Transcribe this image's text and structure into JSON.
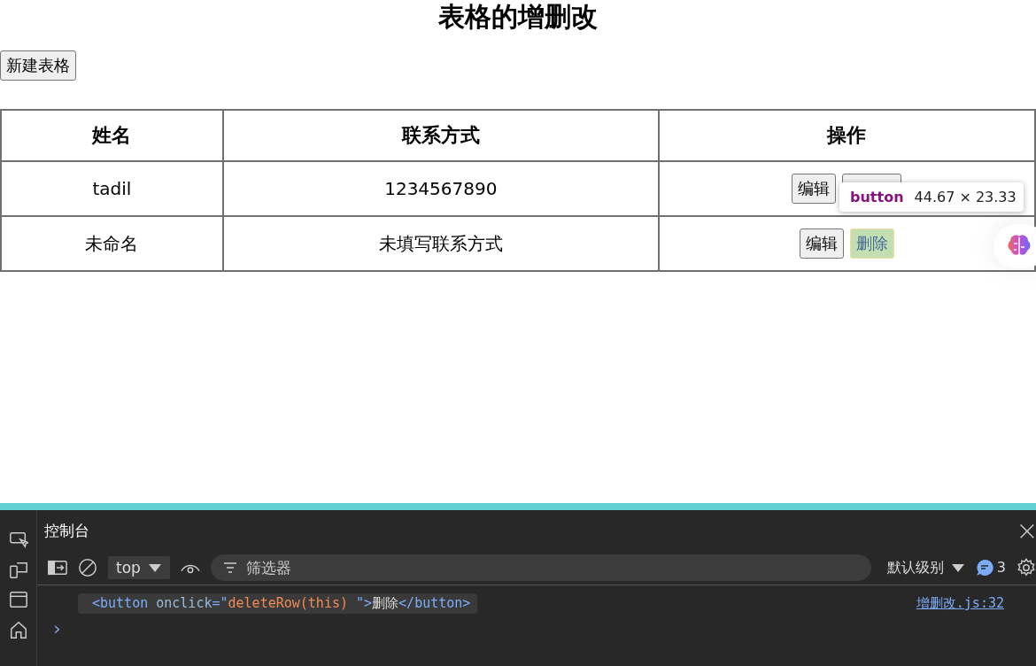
{
  "page": {
    "heading": "表格的增删改",
    "new_button": "新建表格"
  },
  "table": {
    "columns": [
      "姓名",
      "联系方式",
      "操作"
    ],
    "rows": [
      {
        "name": "tadil",
        "contact": "1234567890",
        "actions": [
          {
            "label": "编辑",
            "highlighted": false
          }
        ],
        "covered_button": true
      },
      {
        "name": "未命名",
        "contact": "未填写联系方式",
        "actions": [
          {
            "label": "编辑",
            "highlighted": false
          },
          {
            "label": "删除",
            "highlighted": true
          }
        ],
        "covered_button": false
      }
    ]
  },
  "inspect_tooltip": {
    "tag": "button",
    "size": "44.67 × 23.33"
  },
  "devtools": {
    "tab": "控制台",
    "context": "top",
    "filter_placeholder": "筛选器",
    "level": "默认级别",
    "message_count": "3",
    "log": {
      "code": [
        {
          "kind": "tag",
          "text": "<button "
        },
        {
          "kind": "attr",
          "text": "onclick"
        },
        {
          "kind": "tag",
          "text": "=\""
        },
        {
          "kind": "value",
          "text": "deleteRow(this) "
        },
        {
          "kind": "tag",
          "text": "\">"
        },
        {
          "kind": "plain",
          "text": "删除"
        },
        {
          "kind": "tag",
          "text": "</button>"
        }
      ],
      "source": "增删改.js:32"
    },
    "prompt": "›"
  }
}
